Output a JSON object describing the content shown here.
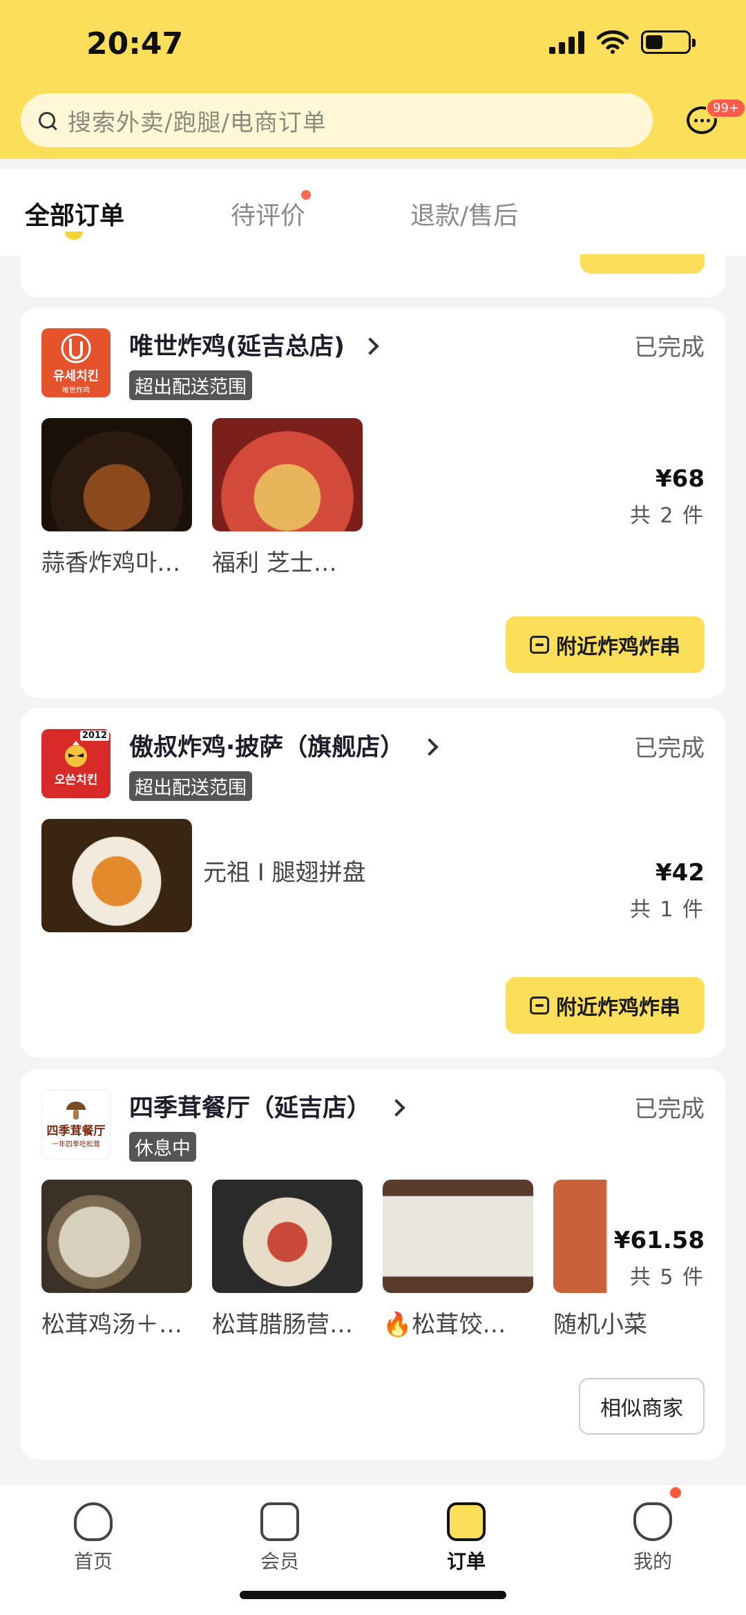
{
  "status_bar": {
    "time": "20:47"
  },
  "search": {
    "placeholder": "搜索外卖/跑腿/电商订单"
  },
  "messages": {
    "badge": "99+"
  },
  "tabs": [
    {
      "label": "全部订单",
      "active": true
    },
    {
      "label": "待评价",
      "active": false,
      "dot": true
    },
    {
      "label": "退款/售后",
      "active": false
    }
  ],
  "orders": [
    {
      "store": "唯世炸鸡(延吉总店)",
      "tag": "超出配送范围",
      "status": "已完成",
      "logo_text": "유세치킨",
      "logo_sub": "唯世炸鸡",
      "items": [
        "蒜香炸鸡마…",
        "福利 芝士…"
      ],
      "price": "¥68",
      "count": "共 2 件",
      "action": "附近炸鸡炸串"
    },
    {
      "store": "傲叔炸鸡·披萨（旗舰店）",
      "tag": "超出配送范围",
      "status": "已完成",
      "logo_text": "오쓴치킨",
      "logo_year": "2012",
      "items": [
        "元祖 I 腿翅拼盘"
      ],
      "price": "¥42",
      "count": "共 1 件",
      "action": "附近炸鸡炸串"
    },
    {
      "store": "四季茸餐厅（延吉店）",
      "tag": "休息中",
      "status": "已完成",
      "logo_text": "四季茸餐厅",
      "logo_sub": "一年四季吃松茸",
      "items": [
        "松茸鸡汤＋…",
        "松茸腊肠营…",
        "🔥松茸饺…",
        "随机小菜"
      ],
      "price": "¥61.58",
      "count": "共 5 件",
      "action": "相似商家"
    }
  ],
  "bottom_nav": [
    {
      "label": "首页",
      "icon": "home-icon"
    },
    {
      "label": "会员",
      "icon": "member-icon"
    },
    {
      "label": "订单",
      "icon": "orders-icon",
      "active": true
    },
    {
      "label": "我的",
      "icon": "profile-icon"
    }
  ],
  "colors": {
    "brand_yellow": "#fbdf5a",
    "badge_red": "#ff5a4a"
  }
}
